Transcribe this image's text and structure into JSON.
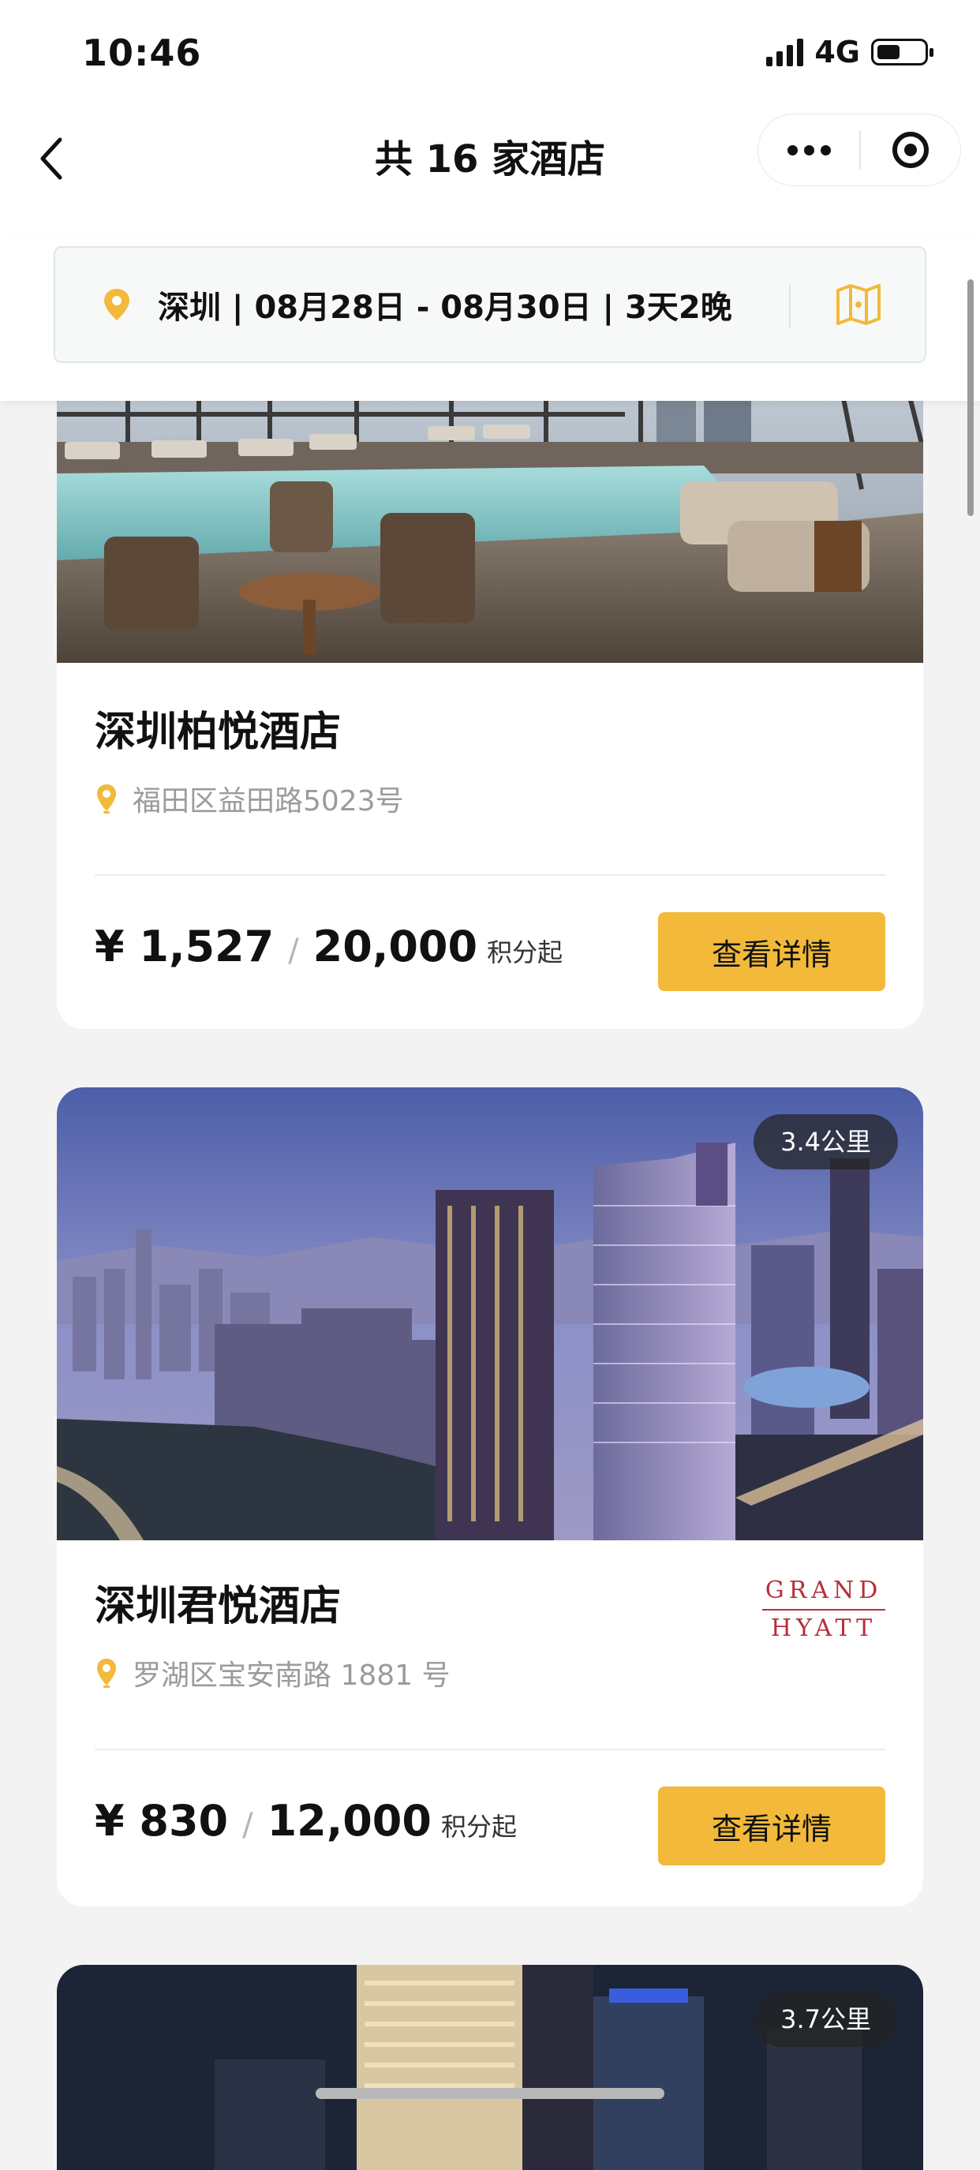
{
  "status_bar": {
    "time": "10:46",
    "network": "4G"
  },
  "nav": {
    "title": "共 16 家酒店"
  },
  "filter": {
    "text": "深圳 | 08月28日 - 08月30日 | 3天2晚"
  },
  "hotels": [
    {
      "name": "深圳柏悦酒店",
      "address": "福田区益田路5023号",
      "price_cash": "¥ 1,527",
      "price_points": "20,000",
      "price_suffix": "积分起",
      "button": "查看详情"
    },
    {
      "name": "深圳君悦酒店",
      "address": "罗湖区宝安南路 1881 号",
      "distance": "3.4公里",
      "brand_top": "GRAND",
      "brand_bottom": "HYATT",
      "price_cash": "¥ 830",
      "price_points": "12,000",
      "price_suffix": "积分起",
      "button": "查看详情"
    },
    {
      "distance": "3.7公里"
    }
  ],
  "colors": {
    "accent": "#f2b93a",
    "brand": "#b52f3a"
  },
  "icons": {
    "back": "chevron-left-icon",
    "more": "more-dots-icon",
    "close": "target-icon",
    "location": "location-pin-icon",
    "map": "map-icon"
  }
}
